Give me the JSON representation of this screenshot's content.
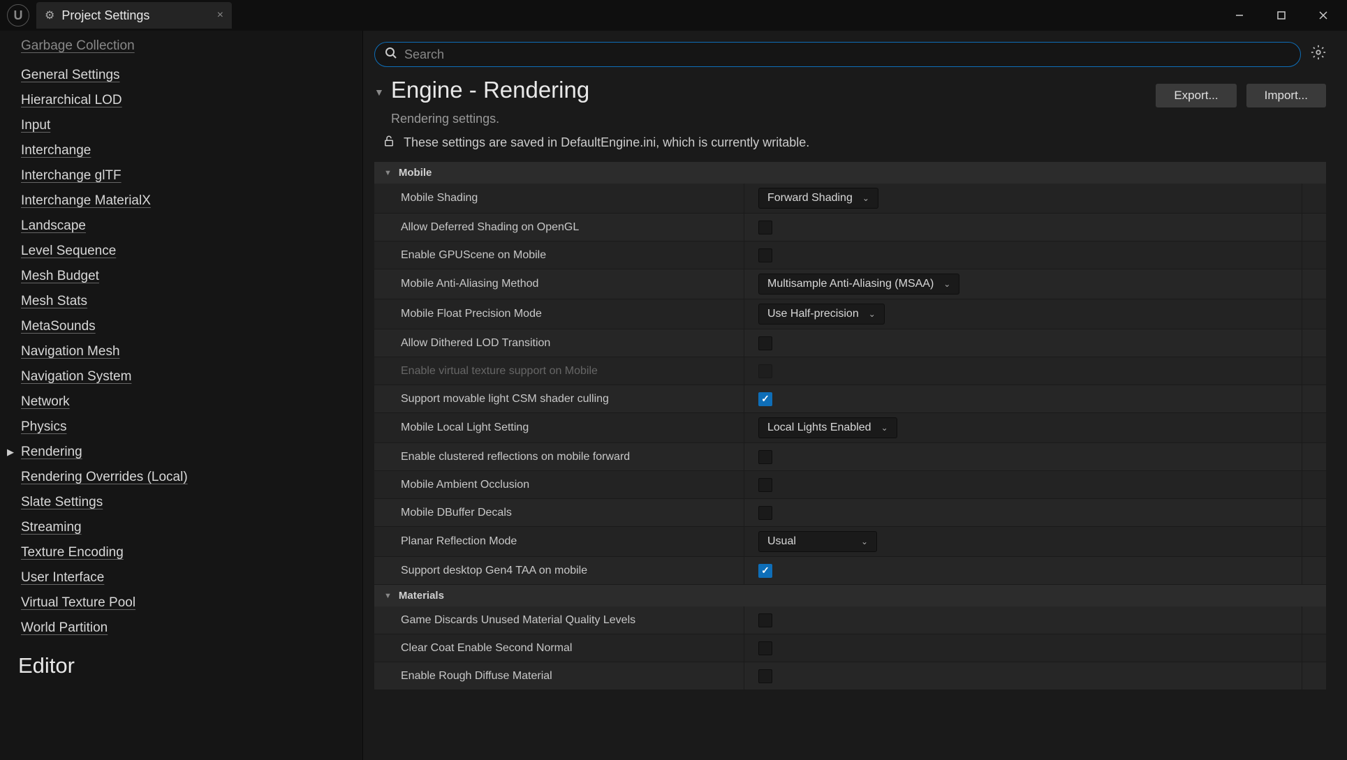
{
  "tab": {
    "title": "Project Settings"
  },
  "search": {
    "placeholder": "Search"
  },
  "page": {
    "title": "Engine - Rendering",
    "subtitle": "Rendering settings.",
    "export_btn": "Export...",
    "import_btn": "Import...",
    "save_info": "These settings are saved in DefaultEngine.ini, which is currently writable."
  },
  "sidebar": {
    "items": [
      {
        "label": "Garbage Collection",
        "cut": true
      },
      {
        "label": "General Settings"
      },
      {
        "label": "Hierarchical LOD"
      },
      {
        "label": "Input"
      },
      {
        "label": "Interchange"
      },
      {
        "label": "Interchange glTF"
      },
      {
        "label": "Interchange MaterialX"
      },
      {
        "label": "Landscape"
      },
      {
        "label": "Level Sequence"
      },
      {
        "label": "Mesh Budget"
      },
      {
        "label": "Mesh Stats"
      },
      {
        "label": "MetaSounds"
      },
      {
        "label": "Navigation Mesh"
      },
      {
        "label": "Navigation System"
      },
      {
        "label": "Network"
      },
      {
        "label": "Physics"
      },
      {
        "label": "Rendering",
        "expandable": true
      },
      {
        "label": "Rendering Overrides (Local)"
      },
      {
        "label": "Slate Settings"
      },
      {
        "label": "Streaming"
      },
      {
        "label": "Texture Encoding"
      },
      {
        "label": "User Interface"
      },
      {
        "label": "Virtual Texture Pool"
      },
      {
        "label": "World Partition"
      }
    ],
    "heading": "Editor"
  },
  "groups": [
    {
      "title": "Mobile",
      "rows": [
        {
          "label": "Mobile Shading",
          "type": "dropdown",
          "value": "Forward Shading"
        },
        {
          "label": "Allow Deferred Shading on OpenGL",
          "type": "checkbox",
          "checked": false
        },
        {
          "label": "Enable GPUScene on Mobile",
          "type": "checkbox",
          "checked": false
        },
        {
          "label": "Mobile Anti-Aliasing Method",
          "type": "dropdown",
          "value": "Multisample Anti-Aliasing (MSAA)",
          "wide": true
        },
        {
          "label": "Mobile Float Precision Mode",
          "type": "dropdown",
          "value": "Use Half-precision"
        },
        {
          "label": "Allow Dithered LOD Transition",
          "type": "checkbox",
          "checked": false
        },
        {
          "label": "Enable virtual texture support on Mobile",
          "type": "checkbox",
          "checked": false,
          "disabled": true
        },
        {
          "label": "Support movable light CSM shader culling",
          "type": "checkbox",
          "checked": true
        },
        {
          "label": "Mobile Local Light Setting",
          "type": "dropdown",
          "value": "Local Lights Enabled"
        },
        {
          "label": "Enable clustered reflections on mobile forward",
          "type": "checkbox",
          "checked": false
        },
        {
          "label": "Mobile Ambient Occlusion",
          "type": "checkbox",
          "checked": false
        },
        {
          "label": "Mobile DBuffer Decals",
          "type": "checkbox",
          "checked": false
        },
        {
          "label": "Planar Reflection Mode",
          "type": "dropdown",
          "value": "Usual"
        },
        {
          "label": "Support desktop Gen4 TAA on mobile",
          "type": "checkbox",
          "checked": true
        }
      ]
    },
    {
      "title": "Materials",
      "rows": [
        {
          "label": "Game Discards Unused Material Quality Levels",
          "type": "checkbox",
          "checked": false
        },
        {
          "label": "Clear Coat Enable Second Normal",
          "type": "checkbox",
          "checked": false
        },
        {
          "label": "Enable Rough Diffuse Material",
          "type": "checkbox",
          "checked": false
        }
      ]
    }
  ]
}
